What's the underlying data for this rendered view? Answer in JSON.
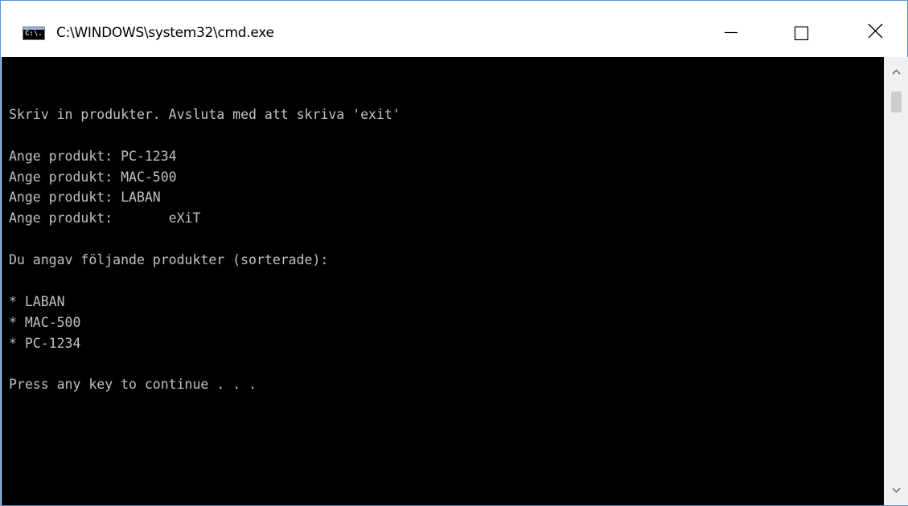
{
  "window": {
    "title": "C:\\WINDOWS\\system32\\cmd.exe",
    "icon_label": "C:\\."
  },
  "console": {
    "lines": [
      "",
      "Skriv in produkter. Avsluta med att skriva 'exit'",
      "",
      "Ange produkt: PC-1234",
      "Ange produkt: MAC-500",
      "Ange produkt: LABAN",
      "Ange produkt:       eXiT",
      "",
      "Du angav följande produkter (sorterade):",
      "",
      "* LABAN",
      "* MAC-500",
      "* PC-1234",
      "",
      "Press any key to continue . . ."
    ]
  },
  "colors": {
    "console_bg": "#000000",
    "console_fg": "#c0c0c0",
    "window_border": "#5a8fd6"
  },
  "icons": {
    "minimize": "minimize-icon",
    "maximize": "maximize-icon",
    "close": "close-icon",
    "scroll_up": "chevron-up-icon",
    "scroll_down": "chevron-down-icon"
  }
}
